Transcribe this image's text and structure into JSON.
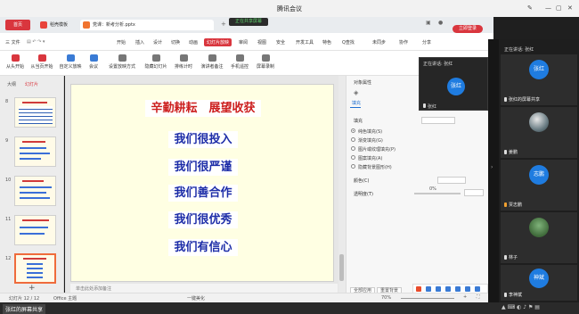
{
  "meeting": {
    "title": "腾讯会议",
    "sharing_badge": "正在共享屏幕",
    "speaking_label": "正在讲话: 张红",
    "speaking_label_float": "正在讲话: 张红"
  },
  "wps": {
    "home_tab": "首页",
    "tabs": [
      {
        "label": "稻壳模板",
        "color": "#e8433b"
      },
      {
        "label": "党课：新考分析.pptx",
        "color": "#f0732f"
      }
    ],
    "login_button": "立即登录",
    "menu": [
      "三 文件",
      "开始",
      "插入",
      "设计",
      "切换",
      "动画",
      "幻灯片放映",
      "审阅",
      "视图",
      "安全",
      "开发工具",
      "特色",
      "Q查找"
    ],
    "menu_active_index": 6,
    "menu_right": [
      "未同步",
      "协作",
      "分享"
    ],
    "toolbar": [
      {
        "label": "从头开始",
        "icon": "play-start-icon",
        "color": "#d9363e"
      },
      {
        "label": "从当页开始",
        "icon": "play-current-icon",
        "color": "#d9363e"
      },
      {
        "label": "自定义放映",
        "icon": "custom-show-icon",
        "color": "#3a7bd5"
      },
      {
        "label": "会议",
        "icon": "meeting-icon",
        "color": "#3a7bd5"
      },
      {
        "label": "设置放映方式",
        "icon": "slideshow-settings-icon",
        "color": "#555555"
      },
      {
        "label": "隐藏幻灯片",
        "icon": "hide-slide-icon",
        "color": "#555555"
      },
      {
        "label": "排练计时",
        "icon": "rehearse-timing-icon",
        "color": "#555555"
      },
      {
        "label": "演讲者备注",
        "icon": "speaker-notes-icon",
        "color": "#555555"
      },
      {
        "label": "手机遥控",
        "icon": "phone-remote-icon",
        "color": "#555555"
      },
      {
        "label": "屏幕录制",
        "icon": "screen-record-icon",
        "color": "#555555"
      }
    ],
    "left_panel": {
      "tabs": [
        "大纲",
        "幻灯片"
      ],
      "slide_numbers": [
        "8",
        "9",
        "10",
        "11",
        "12"
      ],
      "selected_slide": "12"
    },
    "slide": {
      "title": "辛勤耕耘　展望收获",
      "lines": [
        "我们很投入",
        "我们很严谨",
        "我们善合作",
        "我们很优秀",
        "我们有信心"
      ]
    },
    "notes_placeholder": "单击此处添加备注",
    "properties": {
      "heading": "对象属性",
      "fill_tab": "填充",
      "fill_section": "填充",
      "options": [
        "纯色填充(S)",
        "渐变填充(G)",
        "图片或纹理填充(P)",
        "图案填充(A)",
        "隐藏背景图形(H)"
      ],
      "selected_option_index": 0,
      "color_label": "颜色(C)",
      "transparency_label": "透明度(T)",
      "transparency_value": "0%",
      "apply_all_button": "全部应用",
      "reset_button": "重置背景"
    },
    "status": {
      "slide_info": "幻灯片 12 / 12",
      "theme": "Office 主题",
      "beautify": "一键美化",
      "zoom": "70%"
    }
  },
  "participants": {
    "speaking_header": "正在讲话: 张红",
    "floating": {
      "avatar_text": "张红",
      "name": "张红"
    },
    "tiles": [
      {
        "avatar_text": "张红",
        "name": "张红的屏幕共享",
        "color": "#1f7ce0",
        "type": "avatar"
      },
      {
        "name": "姜鹏",
        "type": "photo"
      },
      {
        "avatar_text": "志鹏",
        "name": "贾志鹏",
        "color": "#1f7ce0",
        "type": "avatar"
      },
      {
        "name": "林子",
        "type": "photo"
      },
      {
        "avatar_text": "神斌",
        "name": "李神斌",
        "color": "#1f7ce0",
        "type": "avatar"
      }
    ]
  },
  "taskbar": {
    "share_label": "张红的屏幕共享"
  }
}
